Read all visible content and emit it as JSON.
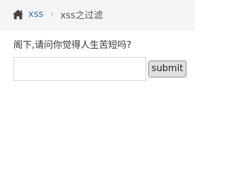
{
  "breadcrumb": {
    "home_icon": "home-icon",
    "link_label": "xss",
    "separator": "›",
    "current_label": "xss之过滤"
  },
  "form": {
    "question": "阁下,请问你觉得人生苦短吗?",
    "input_value": "",
    "submit_label": "submit"
  },
  "colors": {
    "link": "#2e74b5",
    "breadcrumb_bg": "#f5f5f5"
  }
}
